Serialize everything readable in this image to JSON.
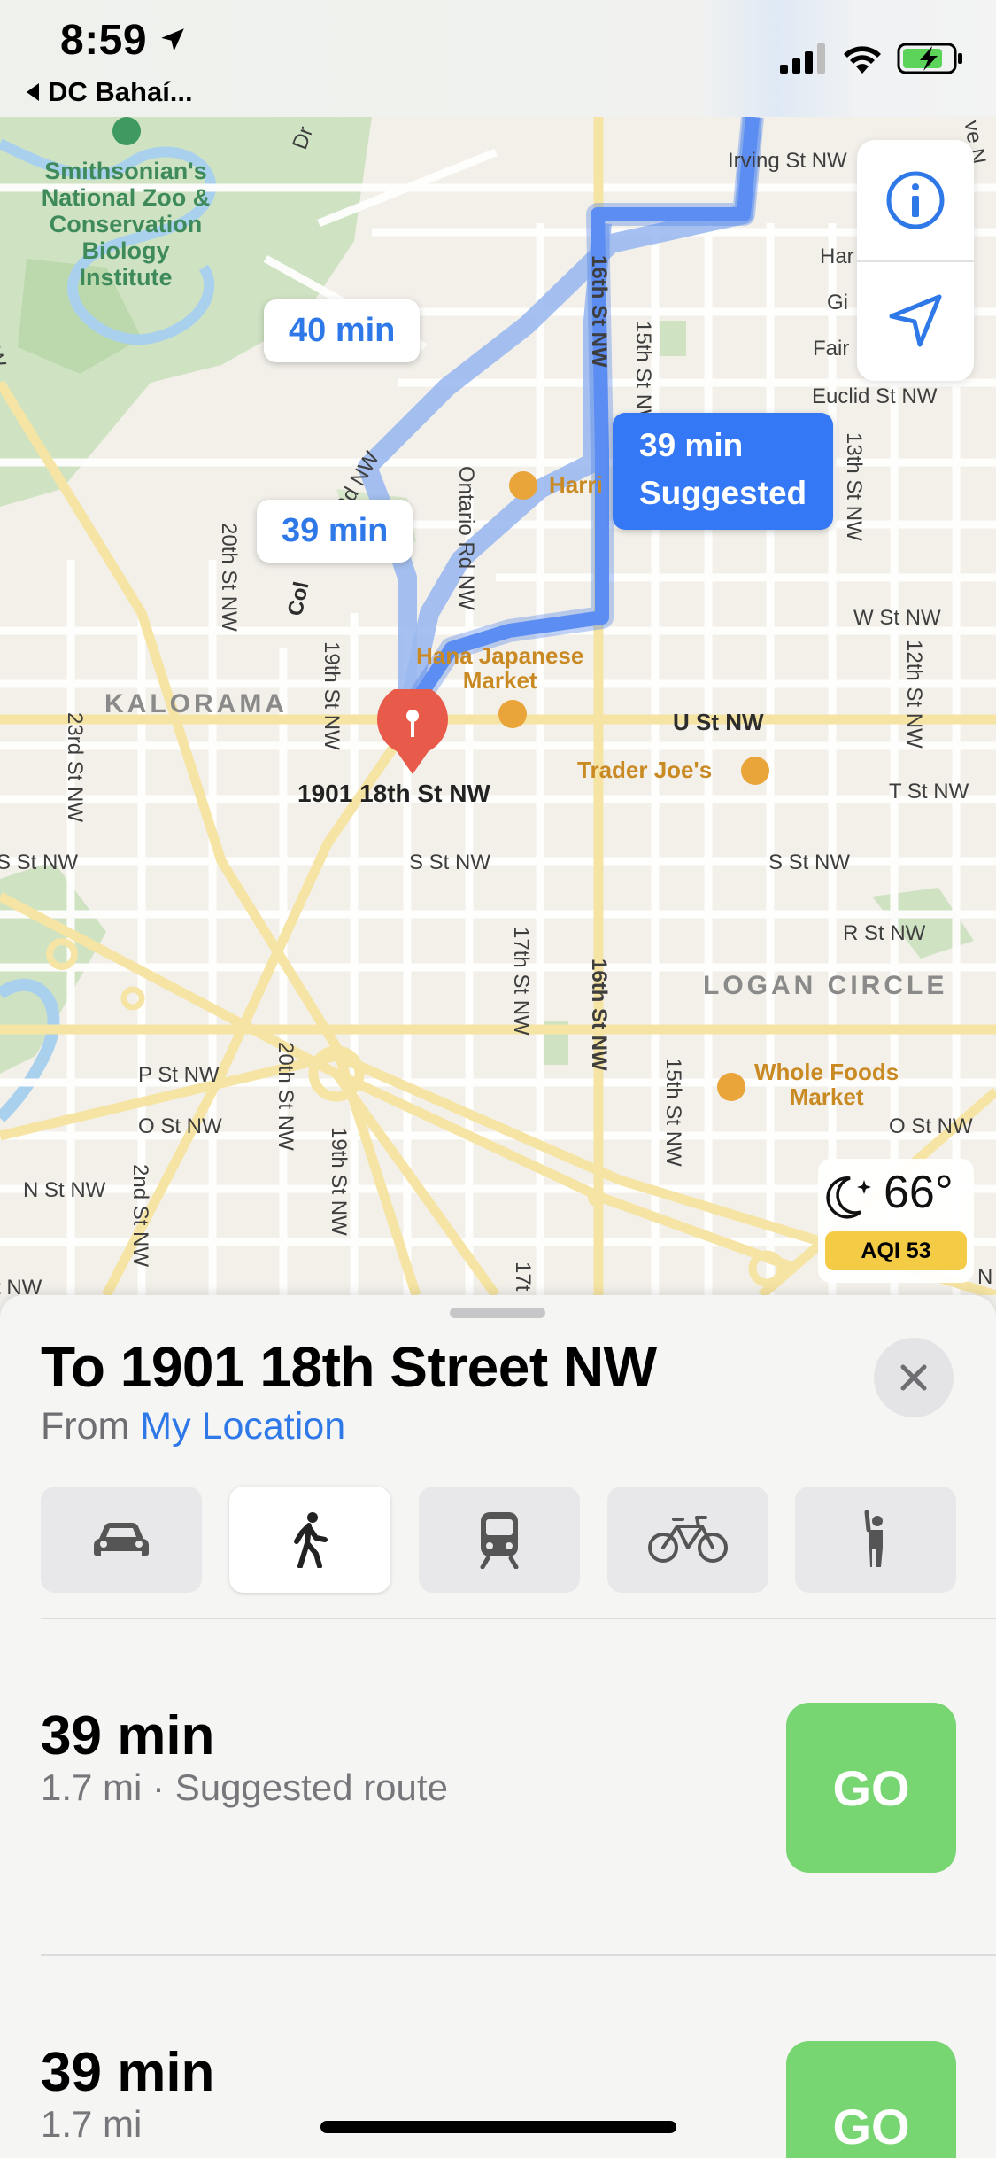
{
  "status_bar": {
    "time": "8:59",
    "back_label": "DC Bahaí..."
  },
  "map": {
    "route_bubbles": {
      "b1": "40 min",
      "b2": "39 min",
      "suggested_time": "39 min",
      "suggested_label": "Suggested"
    },
    "park_label": "Smithsonian's\nNational Zoo &\nConservation\nBiology\nInstitute",
    "neighborhoods": {
      "kalorama": "KALORAMA",
      "logan_circle": "LOGAN CIRCLE"
    },
    "pois": {
      "harris": "Harri",
      "hana": "Hana Japanese\nMarket",
      "trader_joes": "Trader Joe's",
      "whole_foods": "Whole Foods\nMarket"
    },
    "destination_label": "1901 18th St NW",
    "streets": {
      "irving": "Irving St NW",
      "harvard": "Har",
      "girard": "Gi",
      "fairmont": "Fair",
      "euclid": "Euclid St NW",
      "w": "W St NW",
      "u": "U St NW",
      "t": "T St NW",
      "s_west": "S St NW",
      "s_mid": "S St NW",
      "s_east": "S St NW",
      "r": "R St NW",
      "p": "P St NW",
      "o_west": "O St NW",
      "o_east": "O St NW",
      "n": "N St NW",
      "nw_edge": "t NW",
      "ontario": "Ontario Rd NW",
      "columbia": "Col",
      "col_rd": "Rd NW",
      "s16_top": "16th St NW",
      "s16_bottom": "16th St NW",
      "s15_top": "15th St NW",
      "s15_bottom": "15th St NW",
      "s13": "13th St NW",
      "s12": "12th St NW",
      "s17": "17th St NW",
      "s17_bottom": "17t",
      "s19": "19th St NW",
      "s19_bottom": "19th St NW",
      "s20": "20th St NW",
      "s20_bottom": "20th St NW",
      "s22": "2nd St NW",
      "s23": "23rd St NW",
      "nw_left": "NW",
      "dr": "Dr",
      "ve": "ve N",
      "n_edge": "N"
    },
    "weather": {
      "temperature": "66°",
      "aqi": "AQI 53"
    }
  },
  "sheet": {
    "title": "To 1901 18th Street NW",
    "from_prefix": "From",
    "from_location": "My Location",
    "transport_modes": [
      "car-icon",
      "walk-icon",
      "transit-icon",
      "bike-icon",
      "rideshare-icon"
    ],
    "active_mode": "walk",
    "routes": [
      {
        "time": "39 min",
        "detail": "1.7 mi · Suggested route",
        "go_label": "GO"
      },
      {
        "time": "39 min",
        "detail": "1.7 mi",
        "go_label": "GO"
      }
    ]
  },
  "colors": {
    "accent": "#3478f6",
    "route_selected": "#5b8df2",
    "route_alt": "#9bb9f0",
    "go_button": "#77d572",
    "pin": "#e85a4a",
    "aqi_badge": "#f4cb45"
  }
}
